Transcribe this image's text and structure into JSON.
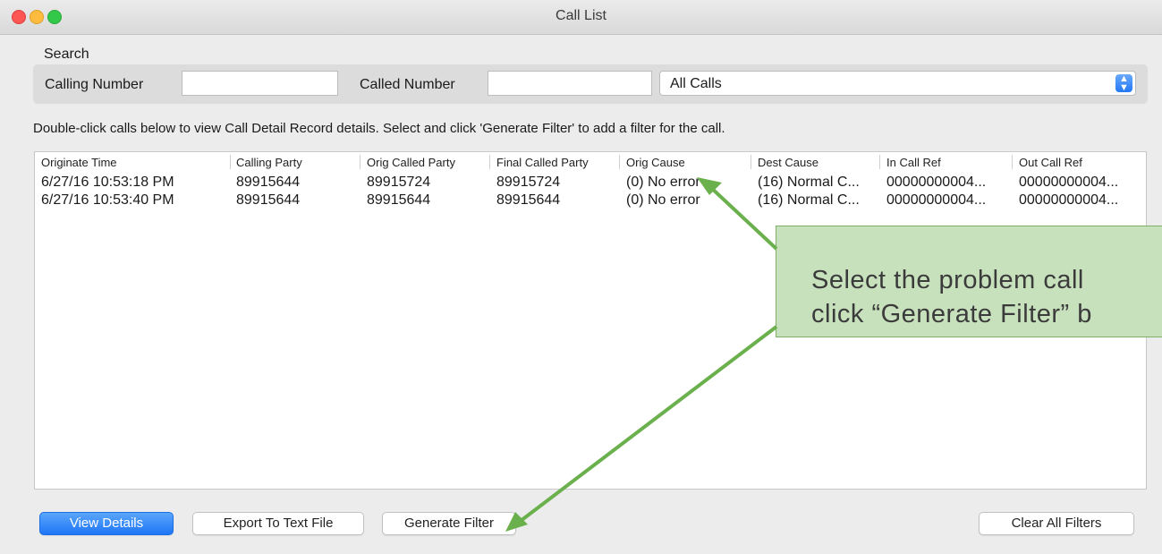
{
  "window": {
    "title": "Call List"
  },
  "search": {
    "heading": "Search",
    "calling_label": "Calling Number",
    "calling_value": "",
    "called_label": "Called Number",
    "called_value": "",
    "filter_selected": "All Calls"
  },
  "instructions": "Double-click calls below to view Call Detail Record details. Select and click 'Generate Filter' to add a filter for the call.",
  "table": {
    "headers": [
      "Originate Time",
      "Calling Party",
      "Orig Called Party",
      "Final Called Party",
      "Orig Cause",
      "Dest Cause",
      "In Call Ref",
      "Out Call Ref"
    ],
    "rows": [
      [
        "6/27/16 10:53:18 PM",
        "89915644",
        "89915724",
        "89915724",
        "(0) No error",
        "(16) Normal C...",
        "00000000004...",
        "00000000004..."
      ],
      [
        "6/27/16 10:53:40 PM",
        "89915644",
        "89915644",
        "89915644",
        "(0) No error",
        "(16) Normal C...",
        "00000000004...",
        "00000000004..."
      ]
    ]
  },
  "buttons": {
    "view_details": "View Details",
    "export": "Export To Text File",
    "generate_filter": "Generate Filter",
    "clear_filters": "Clear All Filters"
  },
  "callout": {
    "line1": "Select the problem call",
    "line2": "click “Generate Filter” b"
  },
  "colors": {
    "accent": "#2378f6",
    "callout_fill": "#c8e1bd",
    "arrow": "#6ab04c"
  }
}
